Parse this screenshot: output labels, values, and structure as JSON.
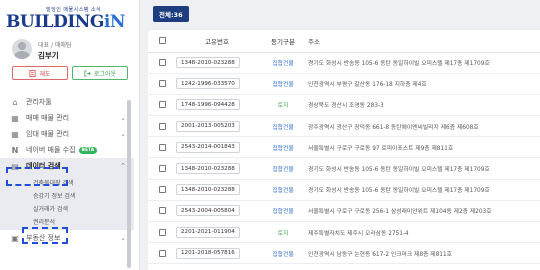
{
  "brand": {
    "tagline": "빌딩인 매물시스템 소식",
    "name_main": "BUILDING",
    "name_accent": "iN"
  },
  "profile": {
    "role": "대표 / 매매팀",
    "name": "김부기"
  },
  "buttons": {
    "logout_left_label": "재도",
    "logout_right_label": "로그아웃"
  },
  "sidebar": {
    "items": [
      {
        "label": "관리자툴"
      },
      {
        "label": "매매 매물 관리"
      },
      {
        "label": "임대 매물 관리"
      },
      {
        "label": "네이버 매물 수집",
        "badge": "BETA"
      },
      {
        "label": "데이터 검색"
      }
    ],
    "submenu": [
      {
        "label": "건축물대장 검색"
      },
      {
        "label": "승강기 정보 검색"
      },
      {
        "label": "실거래가 검색"
      },
      {
        "label": "권리분석"
      }
    ],
    "after": [
      {
        "label": "부동산 정보"
      }
    ]
  },
  "main": {
    "count_label": "전체:36"
  },
  "table": {
    "headers": {
      "number": "고유번호",
      "type": "등기구분",
      "address": "주소"
    },
    "rows": [
      {
        "number": "1348-2010-023288",
        "type": "집합건물",
        "address": "경기도 화성시 반송동 105-6 동탄 동일하이빌 오피스텔 제17층 제1709호"
      },
      {
        "number": "1242-1996-033570",
        "type": "집합건물",
        "address": "인천광역시 부평구 갈산동 176-18 지하층 제4호"
      },
      {
        "number": "1748-1996-094428",
        "type": "토지",
        "address": "경상북도 경산시 조영동 283-3"
      },
      {
        "number": "2001-2013-005203",
        "type": "집합건물",
        "address": "광주광역시 광산구 장덕동 661-8 동탄에이엔씨빌리지 제6층 제608호"
      },
      {
        "number": "2543-2014-001843",
        "type": "집합건물",
        "address": "서울특별시 구로구 구로동 97 로피아포스트 제9층 제811호"
      },
      {
        "number": "1348-2010-023288",
        "type": "집합건물",
        "address": "경기도 화성시 반송동 105-6 동탄 동일하이빌 오피스텔 제17층 제1709호"
      },
      {
        "number": "1348-2010-023288",
        "type": "집합건물",
        "address": "경기도 화성시 반송동 105-6 동탄 동일하이빌 오피스텔 제17층 제1709호"
      },
      {
        "number": "2543-2004-005804",
        "type": "집합건물",
        "address": "서울특별시 구로구 구로동 256-1 삼성래미안위트 제104동 제2층 제203호"
      },
      {
        "number": "2201-2021-011904",
        "type": "토지",
        "address": "제주특별자치도 제주시 오라삼동 2751-4"
      },
      {
        "number": "1201-2018-057816",
        "type": "집합건물",
        "address": "인천광역시 남동구 논현동 617-2 인크마크 제8층 제811호"
      }
    ]
  },
  "colors": {
    "brand_navy": "#1d3d7f",
    "type_building": "#2f6fd1",
    "type_land": "#3aa24c",
    "highlight_dash": "#1f4fd6"
  }
}
